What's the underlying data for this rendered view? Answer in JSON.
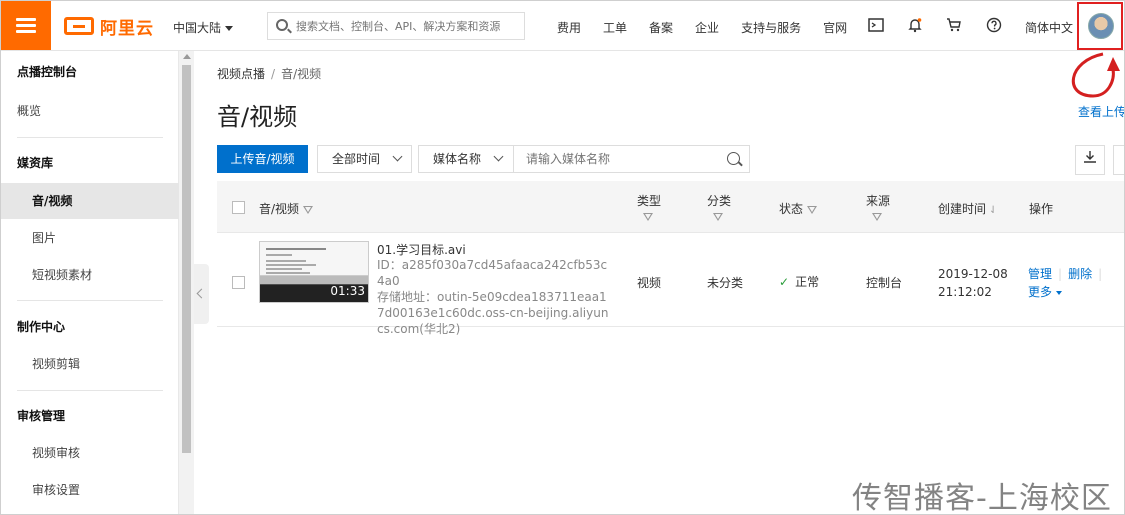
{
  "topbar": {
    "logo_text": "阿里云",
    "region": "中国大陆",
    "search_placeholder": "搜索文档、控制台、API、解决方案和资源",
    "nav": [
      "费用",
      "工单",
      "备案",
      "企业",
      "支持与服务",
      "官网"
    ],
    "language": "简体中文"
  },
  "sidebar": {
    "console_title": "点播控制台",
    "overview": "概览",
    "media_group": "媒资库",
    "media_items": [
      "音/视频",
      "图片",
      "短视频素材"
    ],
    "production_group": "制作中心",
    "production_items": [
      "视频剪辑"
    ],
    "review_group": "审核管理",
    "review_items": [
      "视频审核",
      "审核设置"
    ]
  },
  "main": {
    "breadcrumb_root": "视频点播",
    "breadcrumb_separator": "/",
    "breadcrumb_current": "音/视频",
    "title": "音/视频",
    "help_link": "查看上传",
    "upload_button": "上传音/视频",
    "time_filter": "全部时间",
    "field_filter": "媒体名称",
    "search_placeholder": "请输入媒体名称"
  },
  "table": {
    "headers": {
      "media": "音/视频",
      "type": "类型",
      "category": "分类",
      "status": "状态",
      "source": "来源",
      "created": "创建时间",
      "actions": "操作"
    },
    "rows": [
      {
        "filename": "01.学习目标.avi",
        "id_line": "ID：a285f030a7cd45afaaca242cfb53c4a0",
        "storage_line": "存储地址：outin-5e09cdea183711eaa17d00163e1c60dc.oss-cn-beijing.aliyuncs.com(华北2)",
        "duration": "01:33",
        "type": "视频",
        "category": "未分类",
        "status": "正常",
        "source": "控制台",
        "created_date": "2019-12-08",
        "created_time": "21:12:02",
        "action_manage": "管理",
        "action_delete": "删除",
        "action_more": "更多"
      }
    ]
  },
  "watermark": "传智播客-上海校区",
  "colors": {
    "brand": "#ff6a00",
    "primary": "#0070cc",
    "highlight": "#e02020"
  }
}
